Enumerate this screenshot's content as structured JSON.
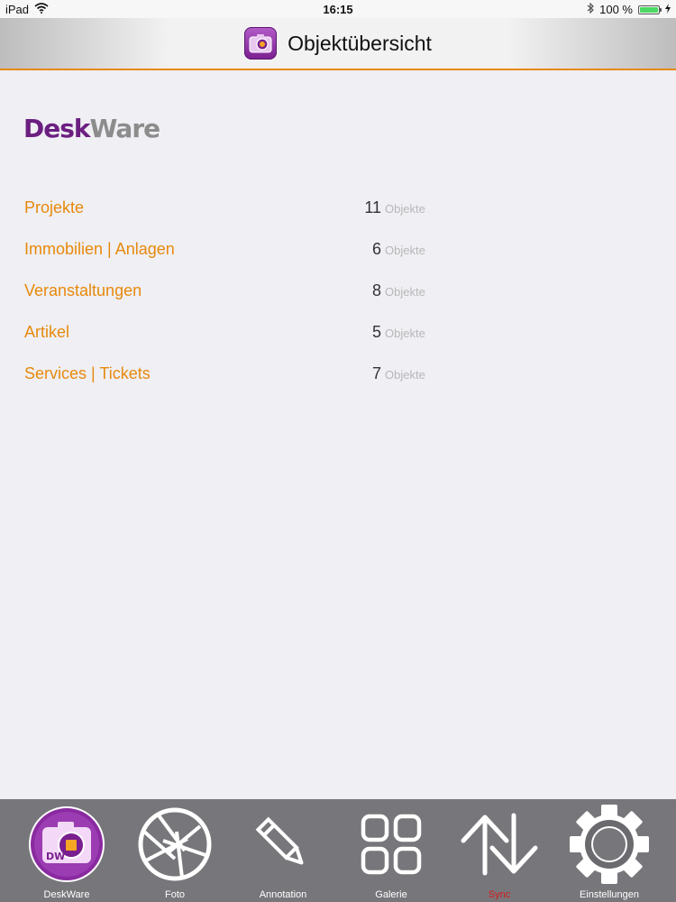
{
  "status_bar": {
    "device": "iPad",
    "time": "16:15",
    "battery": "100 %",
    "battery_level": 1.0
  },
  "nav": {
    "title": "Objektübersicht",
    "app_icon_text": "DW"
  },
  "logo": {
    "part1": "Desk",
    "part2": "Ware"
  },
  "objects": [
    {
      "label": "Projekte",
      "count": "11",
      "unit": "Objekte"
    },
    {
      "label": "Immobilien | Anlagen",
      "count": "6",
      "unit": "Objekte"
    },
    {
      "label": "Veranstaltungen",
      "count": "8",
      "unit": "Objekte"
    },
    {
      "label": "Artikel",
      "count": "5",
      "unit": "Objekte"
    },
    {
      "label": "Services | Tickets",
      "count": "7",
      "unit": "Objekte"
    }
  ],
  "tabs": [
    {
      "label": "DeskWare",
      "icon": "deskware-camera-icon"
    },
    {
      "label": "Foto",
      "icon": "aperture-icon"
    },
    {
      "label": "Annotation",
      "icon": "pencil-icon"
    },
    {
      "label": "Galerie",
      "icon": "gallery-grid-icon"
    },
    {
      "label": "Sync",
      "icon": "sync-arrows-icon",
      "active": true
    },
    {
      "label": "Einstellungen",
      "icon": "gear-icon"
    }
  ],
  "colors": {
    "accent": "#e8890c",
    "brand_purple": "#6c1f80",
    "active_tab": "#d41b1b",
    "tab_bar": "#77777b"
  }
}
